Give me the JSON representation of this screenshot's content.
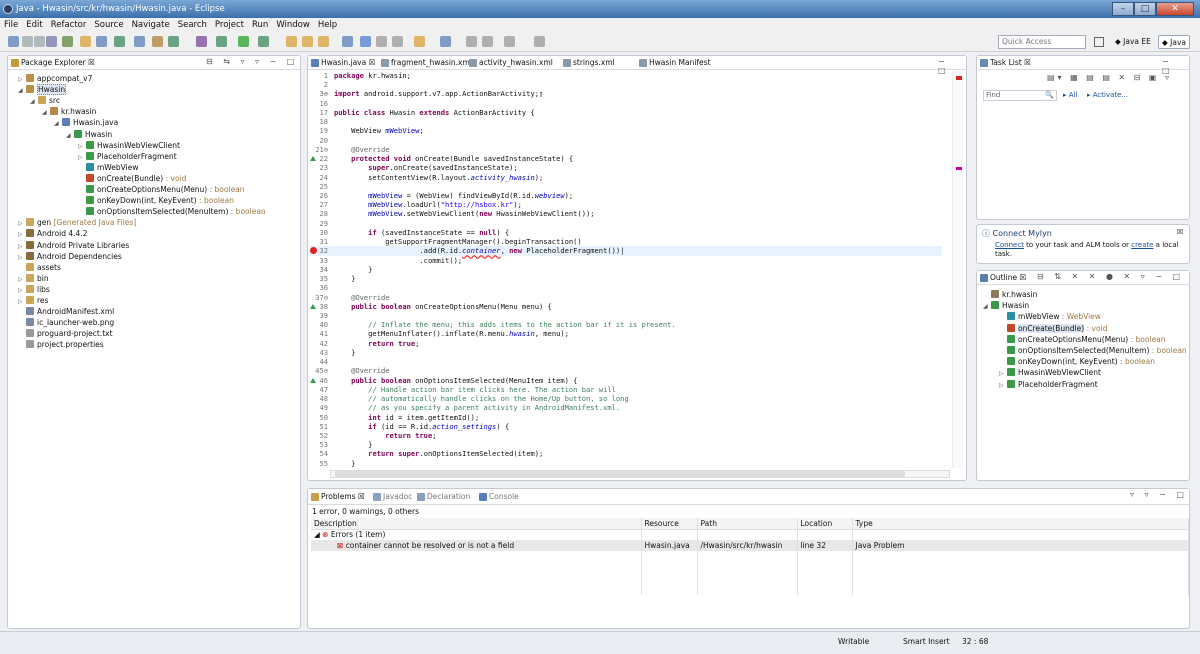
{
  "window": {
    "title": "Java - Hwasin/src/kr/hwasin/Hwasin.java - Eclipse"
  },
  "menu": [
    "File",
    "Edit",
    "Refactor",
    "Source",
    "Navigate",
    "Search",
    "Project",
    "Run",
    "Window",
    "Help"
  ],
  "toolbar": {
    "quick_access": "Quick Access",
    "perspectives": [
      "Java EE",
      "Java"
    ]
  },
  "package_explorer": {
    "title": "Package Explorer",
    "items": [
      {
        "label": "appcompat_v7",
        "suffix": ""
      },
      {
        "label": "Hwasin",
        "suffix": ""
      },
      {
        "label": "src",
        "suffix": ""
      },
      {
        "label": "kr.hwasin",
        "suffix": ""
      },
      {
        "label": "Hwasin.java",
        "suffix": ""
      },
      {
        "label": "Hwasin",
        "suffix": ""
      },
      {
        "label": "HwasinWebViewClient",
        "suffix": ""
      },
      {
        "label": "PlaceholderFragment",
        "suffix": ""
      },
      {
        "label": "mWebView",
        "suffix": ""
      },
      {
        "label": "onCreate(Bundle)",
        "suffix": " : void"
      },
      {
        "label": "onCreateOptionsMenu(Menu)",
        "suffix": " : boolean"
      },
      {
        "label": "onKeyDown(int, KeyEvent)",
        "suffix": " : boolean"
      },
      {
        "label": "onOptionsItemSelected(MenuItem)",
        "suffix": " : boolean"
      },
      {
        "label": "gen",
        "suffix": " [Generated Java Files]"
      },
      {
        "label": "Android 4.4.2",
        "suffix": ""
      },
      {
        "label": "Android Private Libraries",
        "suffix": ""
      },
      {
        "label": "Android Dependencies",
        "suffix": ""
      },
      {
        "label": "assets",
        "suffix": ""
      },
      {
        "label": "bin",
        "suffix": ""
      },
      {
        "label": "libs",
        "suffix": ""
      },
      {
        "label": "res",
        "suffix": ""
      },
      {
        "label": "AndroidManifest.xml",
        "suffix": ""
      },
      {
        "label": "ic_launcher-web.png",
        "suffix": ""
      },
      {
        "label": "proguard-project.txt",
        "suffix": ""
      },
      {
        "label": "project.properties",
        "suffix": ""
      }
    ]
  },
  "editor": {
    "tabs": [
      "Hwasin.java",
      "fragment_hwasin.xml",
      "activity_hwasin.xml",
      "strings.xml",
      "Hwasin Manifest"
    ],
    "lines": [
      {
        "n": "1",
        "html": "<span class=kw>package</span> kr.hwasin;"
      },
      {
        "n": "2",
        "html": ""
      },
      {
        "n": "3⊕",
        "html": "<span class=kw>import</span> android.support.v7.app.ActionBarActivity;▯"
      },
      {
        "n": "16",
        "html": ""
      },
      {
        "n": "17",
        "html": "<span class=kw>public class</span> Hwasin <span class=kw>extends</span> ActionBarActivity {"
      },
      {
        "n": "18",
        "html": ""
      },
      {
        "n": "19",
        "html": "    WebView <span class=fd>mWebView</span>;"
      },
      {
        "n": "20",
        "html": ""
      },
      {
        "n": "21⊖",
        "html": "    <span class=an>@Override</span>"
      },
      {
        "n": "22",
        "html": "    <span class=kw>protected void</span> onCreate(Bundle savedInstanceState) {"
      },
      {
        "n": "23",
        "html": "        <span class=kw>super</span>.onCreate(savedInstanceState);"
      },
      {
        "n": "24",
        "html": "        setContentView(R.layout.<span class='fd it'>activity_hwasin</span>);"
      },
      {
        "n": "25",
        "html": ""
      },
      {
        "n": "26",
        "html": "        <span class=fd>mWebView</span> = (WebView) findViewById(R.id.<span class='fd it'>webview</span>);"
      },
      {
        "n": "27",
        "html": "        <span class=fd>mWebView</span>.loadUrl(<span class=st>\"http://hsbox.kr\"</span>);"
      },
      {
        "n": "28",
        "html": "        <span class=fd>mWebView</span>.setWebViewClient(<span class=kw>new</span> HwasinWebViewClient());"
      },
      {
        "n": "29",
        "html": ""
      },
      {
        "n": "30",
        "html": "        <span class=kw>if</span> (savedInstanceState == <span class=kw>null</span>) {"
      },
      {
        "n": "31",
        "html": "            getSupportFragmentManager().beginTransaction()"
      },
      {
        "n": "32",
        "html": "                    .add(R.id.<span class='fd it' style='text-decoration:underline wavy red'>container</span>, <span class=kw>new</span> PlaceholderFragment())|"
      },
      {
        "n": "33",
        "html": "                    .commit();"
      },
      {
        "n": "34",
        "html": "        }"
      },
      {
        "n": "35",
        "html": "    }"
      },
      {
        "n": "36",
        "html": ""
      },
      {
        "n": "37⊖",
        "html": "    <span class=an>@Override</span>"
      },
      {
        "n": "38",
        "html": "    <span class=kw>public boolean</span> onCreateOptionsMenu(Menu menu) {"
      },
      {
        "n": "39",
        "html": ""
      },
      {
        "n": "40",
        "html": "        <span class=cm>// Inflate the menu; this adds items to the action bar if it is present.</span>"
      },
      {
        "n": "41",
        "html": "        getMenuInflater().inflate(R.menu.<span class='fd it'>hwasin</span>, menu);"
      },
      {
        "n": "42",
        "html": "        <span class=kw>return true</span>;"
      },
      {
        "n": "43",
        "html": "    }"
      },
      {
        "n": "44",
        "html": ""
      },
      {
        "n": "45⊖",
        "html": "    <span class=an>@Override</span>"
      },
      {
        "n": "46",
        "html": "    <span class=kw>public boolean</span> onOptionsItemSelected(MenuItem item) {"
      },
      {
        "n": "47",
        "html": "        <span class=cm>// Handle action bar item clicks here. The action bar will</span>"
      },
      {
        "n": "48",
        "html": "        <span class=cm>// automatically handle clicks on the Home/Up button, so long</span>"
      },
      {
        "n": "49",
        "html": "        <span class=cm>// as you specify a parent activity in AndroidManifest.xml.</span>"
      },
      {
        "n": "50",
        "html": "        <span class=kw>int</span> id = item.getItemId();"
      },
      {
        "n": "51",
        "html": "        <span class=kw>if</span> (id == R.id.<span class='fd it'>action_settings</span>) {"
      },
      {
        "n": "52",
        "html": "            <span class=kw>return true</span>;"
      },
      {
        "n": "53",
        "html": "        }"
      },
      {
        "n": "54",
        "html": "        <span class=kw>return super</span>.onOptionsItemSelected(item);"
      },
      {
        "n": "55",
        "html": "    }"
      }
    ]
  },
  "tasklist": {
    "title": "Task List",
    "find_placeholder": "Find",
    "all": "All",
    "activate": "Activate..."
  },
  "mylyn": {
    "title": "Connect Mylyn",
    "connect": "Connect",
    "middle": " to your task and ALM tools or ",
    "create": "create",
    "end": " a local task."
  },
  "outline": {
    "title": "Outline",
    "items": [
      {
        "label": "kr.hwasin",
        "suffix": ""
      },
      {
        "label": "Hwasin",
        "suffix": ""
      },
      {
        "label": "mWebView",
        "suffix": " : WebView"
      },
      {
        "label": "onCreate(Bundle)",
        "suffix": " : void"
      },
      {
        "label": "onCreateOptionsMenu(Menu)",
        "suffix": " : boolean"
      },
      {
        "label": "onOptionsItemSelected(MenuItem)",
        "suffix": " : boolean"
      },
      {
        "label": "onKeyDown(int, KeyEvent)",
        "suffix": " : boolean"
      },
      {
        "label": "HwasinWebViewClient",
        "suffix": ""
      },
      {
        "label": "PlaceholderFragment",
        "suffix": ""
      }
    ]
  },
  "bottom": {
    "tabs": [
      "Problems",
      "Javadoc",
      "Declaration",
      "Console"
    ],
    "summary": "1 error, 0 warnings, 0 others",
    "columns": [
      "Description",
      "Resource",
      "Path",
      "Location",
      "Type"
    ],
    "group": "Errors (1 item)",
    "row": {
      "description": "container cannot be resolved or is not a field",
      "resource": "Hwasin.java",
      "path": "/Hwasin/src/kr/hwasin",
      "location": "line 32",
      "type": "Java Problem"
    }
  },
  "status": {
    "writable": "Writable",
    "insert": "Smart Insert",
    "position": "32 : 68"
  }
}
